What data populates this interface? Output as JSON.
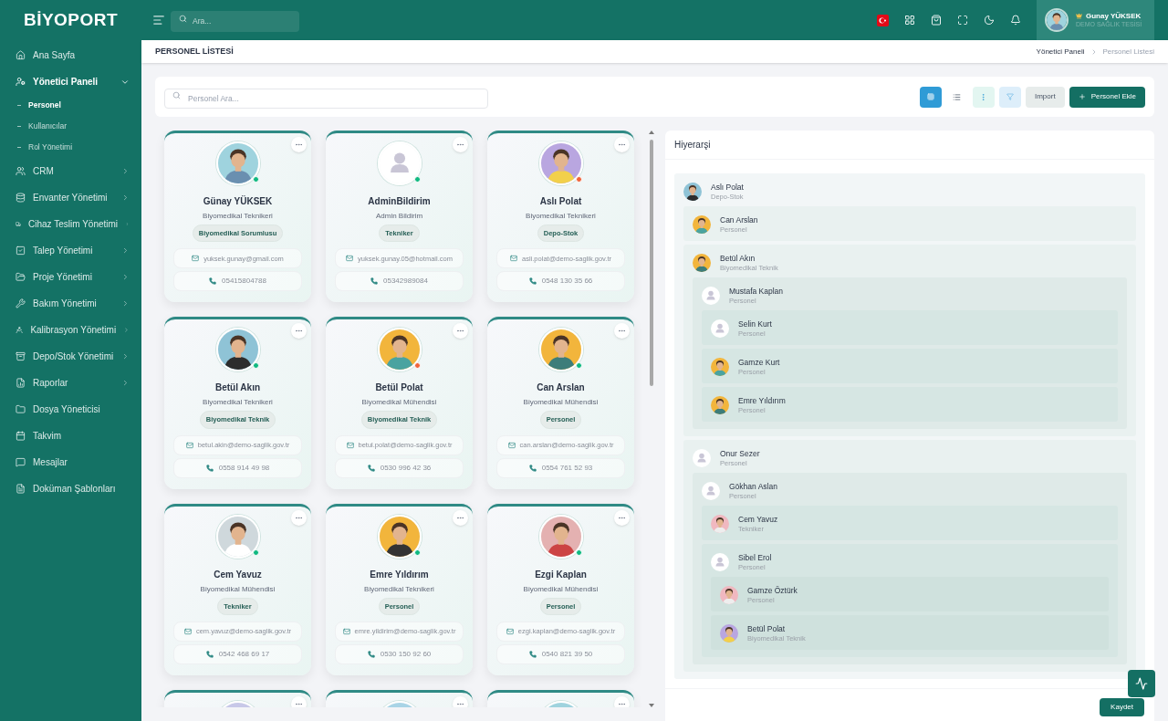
{
  "sidebar": {
    "logo": "BİYOPORT",
    "items": [
      {
        "label": "Ana Sayfa",
        "expandable": false
      },
      {
        "label": "Yönetici Paneli",
        "expandable": true,
        "expanded": true,
        "children": [
          {
            "label": "Personel",
            "selected": true
          },
          {
            "label": "Kullanıcılar",
            "selected": false
          },
          {
            "label": "Rol Yönetimi",
            "selected": false
          }
        ]
      },
      {
        "label": "CRM",
        "expandable": true,
        "expanded": false
      },
      {
        "label": "Envanter Yönetimi",
        "expandable": true,
        "expanded": false
      },
      {
        "label": "Cihaz Teslim Yönetimi",
        "expandable": true,
        "expanded": false
      },
      {
        "label": "Talep Yönetimi",
        "expandable": true,
        "expanded": false
      },
      {
        "label": "Proje Yönetimi",
        "expandable": true,
        "expanded": false
      },
      {
        "label": "Bakım Yönetimi",
        "expandable": true,
        "expanded": false
      },
      {
        "label": "Kalibrasyon Yönetimi",
        "expandable": true,
        "expanded": false
      },
      {
        "label": "Depo/Stok Yönetimi",
        "expandable": true,
        "expanded": false
      },
      {
        "label": "Raporlar",
        "expandable": true,
        "expanded": false
      },
      {
        "label": "Dosya Yöneticisi",
        "expandable": false
      },
      {
        "label": "Takvim",
        "expandable": false
      },
      {
        "label": "Mesajlar",
        "expandable": false
      },
      {
        "label": "Doküman Şablonları",
        "expandable": false
      }
    ]
  },
  "topbar": {
    "search": {
      "placeholder": "Ara..."
    },
    "user": {
      "name": "Gunay YÜKSEK",
      "organization": "DEMO SAĞLIK TESİSİ"
    }
  },
  "page_header": {
    "title": "PERSONEL LİSTESİ",
    "breadcrumb": [
      "Yönetici Paneli",
      "Personel Listesi"
    ]
  },
  "toolbar": {
    "search": {
      "placeholder": "Personel Ara..."
    },
    "view_modes": [
      {
        "selected": true
      },
      {
        "selected": false
      }
    ],
    "import_button": "Import",
    "add_button": "Personel Ekle"
  },
  "cards": [
    {
      "name": "Günay YÜKSEK",
      "title": "Biyomedikal Teknikeri",
      "tag": "Biyomedikal Sorumlusu",
      "email": "yuksek.gunay@gmail.com",
      "phone": "05415804788",
      "avatar": {
        "kind": "picture"
      },
      "color": "#10b981"
    },
    {
      "name": "AdminBildirim",
      "title": "Admin Bildirim",
      "tag": "Tekniker",
      "email": "yuksek.gunay.05@hotmail.com",
      "phone": "05342989084",
      "avatar": {
        "kind": "placeholder"
      },
      "color": "#10b981"
    },
    {
      "name": "Aslı Polat",
      "title": "Biyomedikal Teknikeri",
      "tag": "Depo-Stok",
      "email": "asli.polat@demo-saglik.gov.tr",
      "phone": "0548 130 35 66",
      "avatar": {
        "kind": "picture"
      },
      "color": "#f0643c"
    },
    {
      "name": "Betül Akın",
      "title": "Biyomedikal Teknikeri",
      "tag": "Biyomedikal Teknik",
      "email": "betul.akin@demo-saglik.gov.tr",
      "phone": "0558 914 49 98",
      "avatar": {
        "kind": "picture"
      },
      "color": "#10b981"
    },
    {
      "name": "Betül Polat",
      "title": "Biyomedikal Mühendisi",
      "tag": "Biyomedikal Teknik",
      "email": "betul.polat@demo-saglik.gov.tr",
      "phone": "0530 996 42 36",
      "avatar": {
        "kind": "picture"
      },
      "color": "#f0643c"
    },
    {
      "name": "Can Arslan",
      "title": "Biyomedikal Mühendisi",
      "tag": "Personel",
      "email": "can.arslan@demo-saglik.gov.tr",
      "phone": "0554 761 52 93",
      "avatar": {
        "kind": "picture"
      },
      "color": "#10b981"
    },
    {
      "name": "Cem Yavuz",
      "title": "Biyomedikal Mühendisi",
      "tag": "Tekniker",
      "email": "cem.yavuz@demo-saglik.gov.tr",
      "phone": "0542 468 69 17",
      "avatar": {
        "kind": "picture"
      },
      "color": "#10b981"
    },
    {
      "name": "Emre Yıldırım",
      "title": "Biyomedikal Teknikeri",
      "tag": "Personel",
      "email": "emre.yildirim@demo-saglik.gov.tr",
      "phone": "0530 150 92 60",
      "avatar": {
        "kind": "picture"
      },
      "color": "#10b981"
    },
    {
      "name": "Ezgi Kaplan",
      "title": "Biyomedikal Mühendisi",
      "tag": "Personel",
      "email": "ezgi.kaplan@demo-saglik.gov.tr",
      "phone": "0540 821 39 50",
      "avatar": {
        "kind": "picture"
      },
      "color": "#10b981"
    },
    {
      "avatar": {
        "kind": "picture"
      }
    },
    {
      "avatar": {
        "kind": "picture"
      }
    },
    {
      "avatar": {
        "kind": "picture"
      }
    }
  ],
  "hierarchy": {
    "title": "Hiyerarşi",
    "save_button": "Kaydet",
    "root": {
      "name": "Aslı Polat",
      "role": "Depo-Stok",
      "avatar": {
        "kind": "picture"
      },
      "children": [
        {
          "name": "Can Arslan",
          "role": "Personel",
          "avatar": {
            "kind": "picture"
          }
        },
        {
          "name": "Betül Akın",
          "role": "Biyomedikal Teknik",
          "avatar": {
            "kind": "picture"
          },
          "children": [
            {
              "name": "Mustafa Kaplan",
              "role": "Personel",
              "avatar": {
                "kind": "placeholder"
              },
              "children": [
                {
                  "name": "Selin Kurt",
                  "role": "Personel",
                  "avatar": {
                    "kind": "placeholder"
                  }
                },
                {
                  "name": "Gamze Kurt",
                  "role": "Personel",
                  "avatar": {
                    "kind": "picture"
                  }
                },
                {
                  "name": "Emre Yıldırım",
                  "role": "Personel",
                  "avatar": {
                    "kind": "picture"
                  }
                }
              ]
            }
          ]
        },
        {
          "name": "Onur Sezer",
          "role": "Personel",
          "avatar": {
            "kind": "placeholder"
          },
          "children": [
            {
              "name": "Gökhan Aslan",
              "role": "Personel",
              "avatar": {
                "kind": "placeholder"
              },
              "children": [
                {
                  "name": "Cem Yavuz",
                  "role": "Tekniker",
                  "avatar": {
                    "kind": "picture"
                  }
                },
                {
                  "name": "Sibel Erol",
                  "role": "Personel",
                  "avatar": {
                    "kind": "placeholder"
                  },
                  "children": [
                    {
                      "name": "Gamze Öztürk",
                      "role": "Personel",
                      "avatar": {
                        "kind": "picture"
                      }
                    },
                    {
                      "name": "Betül Polat",
                      "role": "Biyomedikal Teknik",
                      "avatar": {
                        "kind": "picture"
                      }
                    }
                  ]
                }
              ]
            }
          ]
        }
      ]
    }
  }
}
